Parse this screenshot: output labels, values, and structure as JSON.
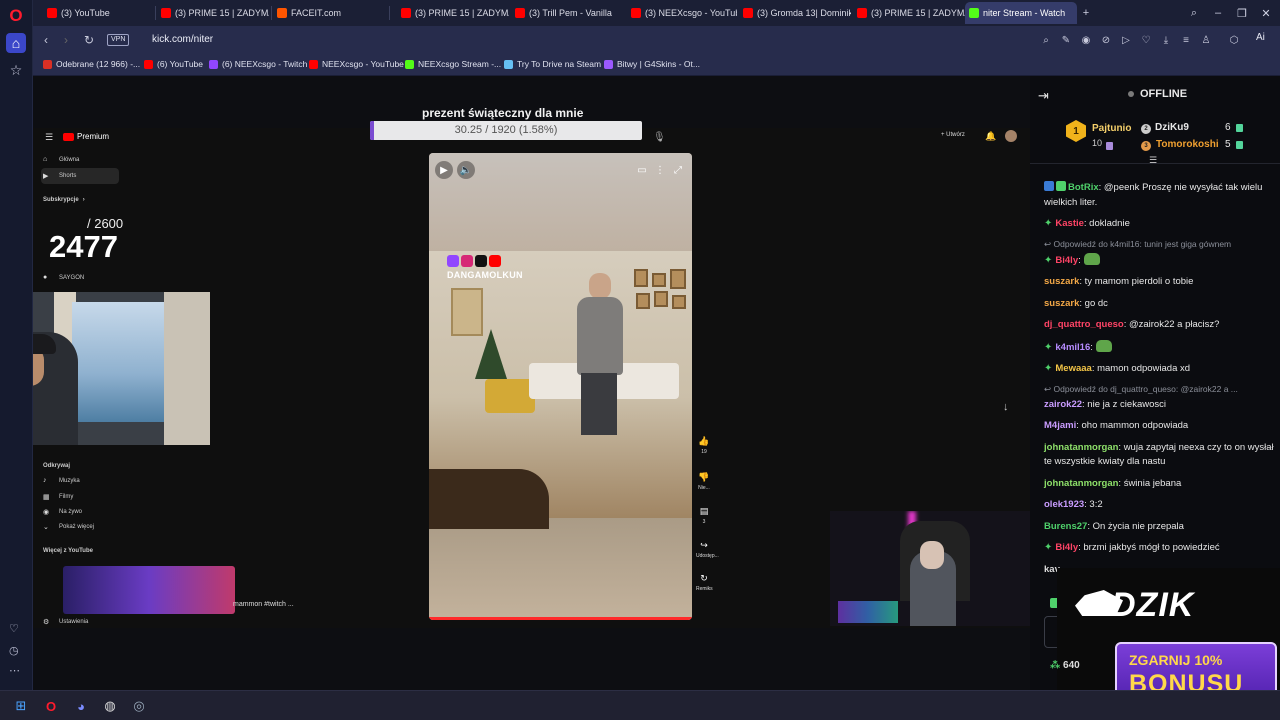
{
  "tabs": [
    {
      "title": "(3) YouTube",
      "color": "#ff0000"
    },
    {
      "title": "(3) PRIME 15 | ZADYMA",
      "color": "#ff0000"
    },
    {
      "title": "FACEIT.com",
      "color": "#ff5500"
    },
    {
      "title": "(3) PRIME 15 | ZADYMA",
      "color": "#ff0000"
    },
    {
      "title": "(3) Trill Pem - Vanilla",
      "color": "#ff0000"
    },
    {
      "title": "(3) NEEXcsgo - YouTube",
      "color": "#ff0000"
    },
    {
      "title": "(3) Gromda 13| Dominik",
      "color": "#ff0000"
    },
    {
      "title": "(3) PRIME 15 | ZADYMA",
      "color": "#ff0000"
    },
    {
      "title": "niter Stream - Watch",
      "color": "#53fc18"
    }
  ],
  "address": {
    "vpn": "VPN",
    "url": "kick.com/niter",
    "ai": "Ai"
  },
  "bookmarks": [
    {
      "label": "Odebrane (12 966) -...",
      "color": "#d93025"
    },
    {
      "label": "(6) YouTube",
      "color": "#ff0000"
    },
    {
      "label": "(6) NEEXcsgo - Twitch",
      "color": "#9146ff"
    },
    {
      "label": "NEEXcsgo - YouTube",
      "color": "#ff0000"
    },
    {
      "label": "NEEXcsgo Stream -...",
      "color": "#53fc18"
    },
    {
      "label": "Try To Drive na Steam",
      "color": "#66c0f4"
    },
    {
      "label": "Bitwy | G4Skins - Ot...",
      "color": "#9b59ff"
    }
  ],
  "stream": {
    "overlay_title": "prezent świąteczny dla mnie",
    "goal_text": "30.25 / 1920 (1.58%)",
    "goal_fraction": 0.0158,
    "counter_goal": "/ 2600",
    "counter_value": "2477",
    "promo_hashtag": "mammon #twitch ..."
  },
  "youtube": {
    "logo": "Premium",
    "create": "+ Utwórz",
    "sidebar": [
      {
        "label": "Główna",
        "icon": "home-icon"
      },
      {
        "label": "Shorts",
        "icon": "shorts-icon"
      },
      {
        "label": "Subskrypcje",
        "icon": "chevron-right-icon"
      },
      {
        "label": "SAYGON",
        "icon": "avatar"
      },
      {
        "label": "Odkrywaj",
        "icon": ""
      },
      {
        "label": "Muzyka",
        "icon": "music-icon"
      },
      {
        "label": "Filmy",
        "icon": "film-icon"
      },
      {
        "label": "Na żywo",
        "icon": "live-icon"
      },
      {
        "label": "Pokaż więcej",
        "icon": "chevron-down-icon"
      },
      {
        "label": "Więcej z YouTube",
        "icon": ""
      },
      {
        "label": "Ustawienia",
        "icon": "gear-icon"
      }
    ],
    "short_handle": "DANGAMOLKUN",
    "short_actions": [
      {
        "icon": "like-icon",
        "label": "19"
      },
      {
        "icon": "dislike-icon",
        "label": "Nie..."
      },
      {
        "icon": "comment-icon",
        "label": "3"
      },
      {
        "icon": "share-icon",
        "label": "Udostęp..."
      },
      {
        "icon": "remix-icon",
        "label": "Remiks"
      }
    ]
  },
  "chat": {
    "status": "OFFLINE",
    "top_gifters": [
      {
        "name": "Pajtunio",
        "count": "10",
        "rank": "1"
      },
      {
        "name": "DziKu9",
        "count": "6",
        "rank": "2"
      },
      {
        "name": "Tomorokoshi",
        "count": "5",
        "rank": "3"
      }
    ],
    "messages": [
      {
        "type": "msg",
        "user": "BotRix",
        "color": "#4fd16b",
        "text": ": @peenk Proszę nie wysyłać tak wielu wielkich liter.",
        "badges": [
          "#3a7bd5",
          "#4fd16b"
        ],
        "star": false,
        "emote": false
      },
      {
        "type": "msg",
        "user": "Kastie",
        "color": "#ff4466",
        "text": ": dokladnie",
        "badges": [],
        "star": true,
        "emote": false
      },
      {
        "type": "reply",
        "text": "Odpowiedź do k4mil16: tunin jest giga gównem"
      },
      {
        "type": "msg",
        "user": "Bi4ly",
        "color": "#ff4466",
        "text": ":",
        "badges": [],
        "star": true,
        "emote": true
      },
      {
        "type": "msg",
        "user": "suszark",
        "color": "#f3a847",
        "text": ": ty mamom pierdoli o tobie",
        "badges": [],
        "star": false,
        "emote": false
      },
      {
        "type": "msg",
        "user": "suszark",
        "color": "#f3a847",
        "text": ": go dc",
        "badges": [],
        "star": false,
        "emote": false
      },
      {
        "type": "msg",
        "user": "dj_quattro_queso",
        "color": "#ff4466",
        "text": ": @zairok22 a płacisz?",
        "badges": [],
        "star": false,
        "emote": false
      },
      {
        "type": "msg",
        "user": "k4mil16",
        "color": "#b78cff",
        "text": ":",
        "badges": [],
        "star": true,
        "emote": true
      },
      {
        "type": "msg",
        "user": "Mewaaa",
        "color": "#f3c547",
        "text": ": mamon odpowiada xd",
        "badges": [],
        "star": true,
        "emote": false
      },
      {
        "type": "reply",
        "text": "Odpowiedź do dj_quattro_queso: @zairok22 a ..."
      },
      {
        "type": "msg",
        "user": "zairok22",
        "color": "#c99cff",
        "text": ": nie ja z ciekawosci",
        "badges": [],
        "star": false,
        "emote": false
      },
      {
        "type": "msg",
        "user": "M4jami",
        "color": "#c99cff",
        "text": ": oho mammon odpowiada",
        "badges": [],
        "star": false,
        "emote": false
      },
      {
        "type": "msg",
        "user": "johnatanmorgan",
        "color": "#8ee06a",
        "text": ": wuja zapytaj neexa czy to on wysłał te wszystkie kwiaty dla nastu",
        "badges": [],
        "star": false,
        "emote": false
      },
      {
        "type": "msg",
        "user": "johnatanmorgan",
        "color": "#8ee06a",
        "text": ": świnia jebana",
        "badges": [],
        "star": false,
        "emote": false
      },
      {
        "type": "msg",
        "user": "olek1923",
        "color": "#c99cff",
        "text": ": 3:2",
        "badges": [],
        "star": false,
        "emote": false
      },
      {
        "type": "msg",
        "user": "Burens27",
        "color": "#4fd16b",
        "text": ": On życia nie przepala",
        "badges": [],
        "star": false,
        "emote": false
      },
      {
        "type": "msg",
        "user": "Bi4ly",
        "color": "#ff4466",
        "text": ": brzmi jakbyś mógł to powiedzieć",
        "badges": [],
        "star": true,
        "emote": false
      },
      {
        "type": "msg",
        "user": "kav",
        "color": "#ddd",
        "text": "",
        "badges": [],
        "star": false,
        "emote": false
      }
    ],
    "ad": {
      "brand": "DZIK",
      "line1": "ZGARNIJ 10%",
      "line2": "BONUSU"
    },
    "viewers": "640"
  }
}
